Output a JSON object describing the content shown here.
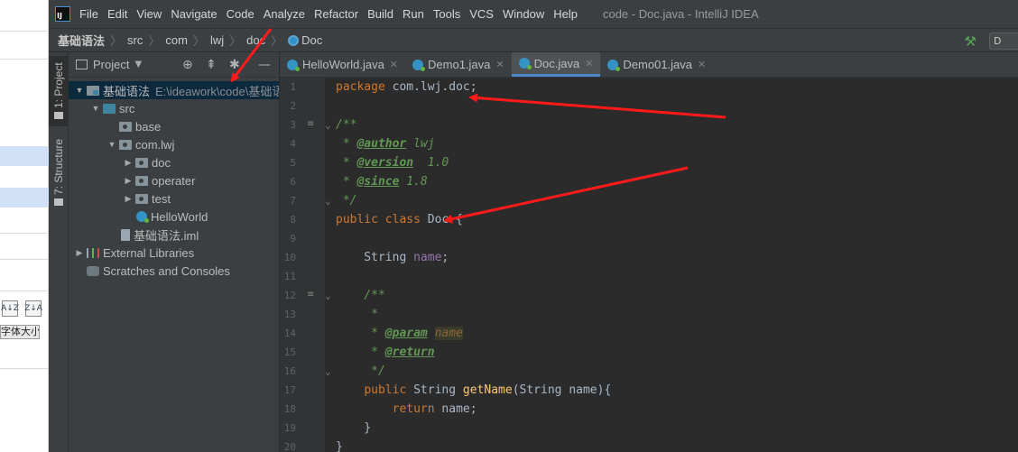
{
  "background_app": {
    "toolbar_icons": [
      "A↓Z",
      "Z↓A"
    ],
    "font_size_tag": "字体大小"
  },
  "menubar": {
    "items": [
      "File",
      "Edit",
      "View",
      "Navigate",
      "Code",
      "Analyze",
      "Refactor",
      "Build",
      "Run",
      "Tools",
      "VCS",
      "Window",
      "Help"
    ],
    "window_title": "code - Doc.java - IntelliJ IDEA",
    "logo_text": "IJ"
  },
  "navbar": {
    "crumbs": [
      "基础语法",
      "src",
      "com",
      "lwj",
      "doc",
      "Doc"
    ],
    "run_config_text": "D"
  },
  "tool_stripe": {
    "project_label": "1: Project",
    "structure_label": "7: Structure"
  },
  "project_panel": {
    "view_label": "Project",
    "tree": [
      {
        "label": "基础语法",
        "hint": "E:\\ideawork\\code\\基础语法",
        "icon": "module",
        "arrow": "▼",
        "depth": 0,
        "selected": true
      },
      {
        "label": "src",
        "icon": "folder-blue",
        "arrow": "▼",
        "depth": 1
      },
      {
        "label": "base",
        "icon": "package",
        "arrow": "",
        "depth": 2
      },
      {
        "label": "com.lwj",
        "icon": "package",
        "arrow": "▼",
        "depth": 2
      },
      {
        "label": "doc",
        "icon": "package",
        "arrow": "▶",
        "depth": 3
      },
      {
        "label": "operater",
        "icon": "package",
        "arrow": "▶",
        "depth": 3
      },
      {
        "label": "test",
        "icon": "package",
        "arrow": "▶",
        "depth": 3
      },
      {
        "label": "HelloWorld",
        "icon": "class",
        "arrow": "",
        "depth": 3
      },
      {
        "label": "基础语法.iml",
        "icon": "iml",
        "arrow": "",
        "depth": 2
      },
      {
        "label": "External Libraries",
        "icon": "libs",
        "arrow": "▶",
        "depth": 0
      },
      {
        "label": "Scratches and Consoles",
        "icon": "scratch",
        "arrow": "",
        "depth": 0
      }
    ]
  },
  "editor": {
    "tabs": [
      {
        "label": "HelloWorld.java",
        "active": false
      },
      {
        "label": "Demo1.java",
        "active": false
      },
      {
        "label": "Doc.java",
        "active": true
      },
      {
        "label": "Demo01.java",
        "active": false
      }
    ],
    "line_numbers": [
      "1",
      "2",
      "3",
      "4",
      "5",
      "6",
      "7",
      "8",
      "9",
      "10",
      "11",
      "12",
      "13",
      "14",
      "15",
      "16",
      "17",
      "18",
      "19",
      "20"
    ],
    "code_lines": [
      [
        {
          "t": "kw",
          "v": "package "
        },
        {
          "t": "plain",
          "v": "com.lwj.doc;"
        }
      ],
      [],
      [
        {
          "t": "doc",
          "v": "/**"
        }
      ],
      [
        {
          "t": "doc",
          "v": " * "
        },
        {
          "t": "doc-tag",
          "v": "@author"
        },
        {
          "t": "doc",
          "v": " lwj"
        }
      ],
      [
        {
          "t": "doc",
          "v": " * "
        },
        {
          "t": "doc-tag",
          "v": "@version"
        },
        {
          "t": "doc",
          "v": "  1.0"
        }
      ],
      [
        {
          "t": "doc",
          "v": " * "
        },
        {
          "t": "doc-tag",
          "v": "@since"
        },
        {
          "t": "doc",
          "v": " 1.8"
        }
      ],
      [
        {
          "t": "doc",
          "v": " */"
        }
      ],
      [
        {
          "t": "kw",
          "v": "public class "
        },
        {
          "t": "plain",
          "v": "Doc {"
        }
      ],
      [],
      [
        {
          "t": "plain",
          "v": "    String "
        },
        {
          "t": "field",
          "v": "name"
        },
        {
          "t": "plain",
          "v": ";"
        }
      ],
      [],
      [
        {
          "t": "doc",
          "v": "    /**"
        }
      ],
      [
        {
          "t": "doc",
          "v": "     *"
        }
      ],
      [
        {
          "t": "doc",
          "v": "     * "
        },
        {
          "t": "doc-tag",
          "v": "@param"
        },
        {
          "t": "doc",
          "v": " "
        },
        {
          "t": "doc-ref",
          "v": "name"
        }
      ],
      [
        {
          "t": "doc",
          "v": "     * "
        },
        {
          "t": "doc-tag",
          "v": "@return"
        }
      ],
      [
        {
          "t": "doc",
          "v": "     */"
        }
      ],
      [
        {
          "t": "plain",
          "v": "    "
        },
        {
          "t": "kw",
          "v": "public "
        },
        {
          "t": "plain",
          "v": "String "
        },
        {
          "t": "method",
          "v": "getName"
        },
        {
          "t": "plain",
          "v": "(String name){"
        }
      ],
      [
        {
          "t": "plain",
          "v": "        "
        },
        {
          "t": "kw",
          "v": "return "
        },
        {
          "t": "plain",
          "v": "name;"
        }
      ],
      [
        {
          "t": "plain",
          "v": "    }"
        }
      ],
      [
        {
          "t": "plain",
          "v": "}"
        }
      ]
    ]
  },
  "colors": {
    "annotation_red": "#ff1a1a",
    "selection": "#0d293e",
    "keyword": "#cc7832",
    "doc_comment": "#629755"
  }
}
